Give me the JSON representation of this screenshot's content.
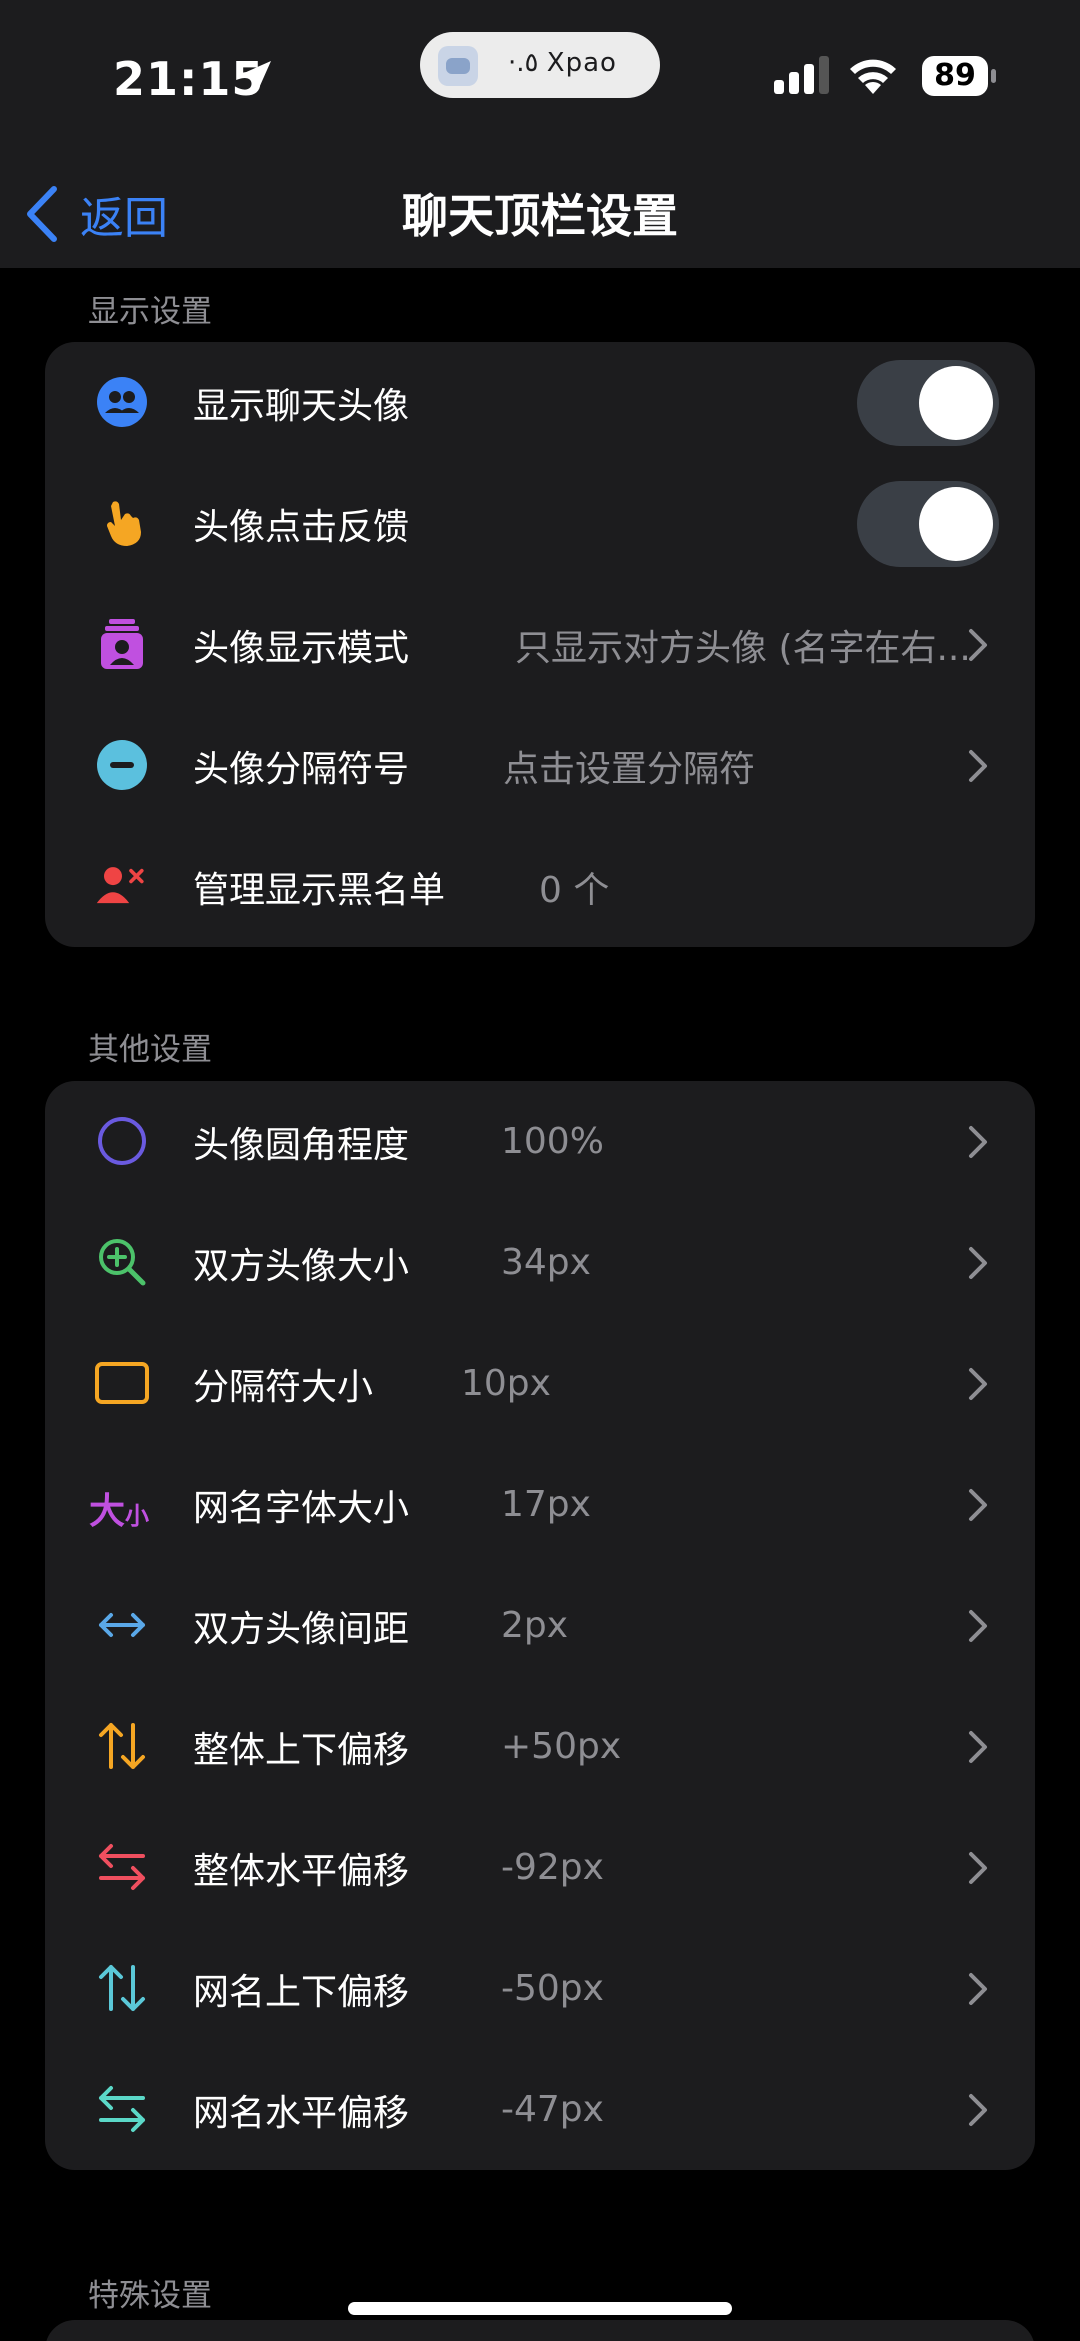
{
  "status_bar": {
    "time": "21:15",
    "island_text": "·.٥  Xpao",
    "battery": "89"
  },
  "nav": {
    "back_label": "返回",
    "title": "聊天顶栏设置"
  },
  "sections": [
    {
      "header": "显示设置",
      "rows": [
        {
          "icon": "people-icon",
          "label": "显示聊天头像",
          "value": "",
          "control": "toggle",
          "toggle_on": true
        },
        {
          "icon": "pointing-hand-icon",
          "label": "头像点击反馈",
          "value": "",
          "control": "toggle",
          "toggle_on": true
        },
        {
          "icon": "contact-card-icon",
          "label": "头像显示模式",
          "value": "只显示对方头像 (名字在右...",
          "control": "chevron"
        },
        {
          "icon": "minus-circle-icon",
          "label": "头像分隔符号",
          "value": "点击设置分隔符",
          "control": "chevron"
        },
        {
          "icon": "user-remove-icon",
          "label": "管理显示黑名单",
          "value": "0 个",
          "control": "none"
        }
      ]
    },
    {
      "header": "其他设置",
      "rows": [
        {
          "icon": "circle-outline-icon",
          "label": "头像圆角程度",
          "value": "100%",
          "control": "chevron"
        },
        {
          "icon": "zoom-in-icon",
          "label": "双方头像大小",
          "value": "34px",
          "control": "chevron"
        },
        {
          "icon": "rectangle-icon",
          "label": "分隔符大小",
          "value": "10px",
          "control": "chevron"
        },
        {
          "icon": "font-size-icon",
          "icon_text_big": "大",
          "icon_text_small": "小",
          "label": "网名字体大小",
          "value": "17px",
          "control": "chevron"
        },
        {
          "icon": "horizontal-arrows-icon",
          "label": "双方头像间距",
          "value": "2px",
          "control": "chevron"
        },
        {
          "icon": "vertical-arrows-icon",
          "label": "整体上下偏移",
          "value": "+50px",
          "control": "chevron"
        },
        {
          "icon": "swap-horizontal-icon",
          "label": "整体水平偏移",
          "value": "-92px",
          "control": "chevron"
        },
        {
          "icon": "vertical-arrows-icon",
          "label": "网名上下偏移",
          "value": "-50px",
          "control": "chevron"
        },
        {
          "icon": "swap-horizontal-icon",
          "label": "网名水平偏移",
          "value": "-47px",
          "control": "chevron"
        }
      ]
    },
    {
      "header": "特殊设置",
      "rows": []
    }
  ],
  "colors": {
    "accent": "#3b82f6",
    "background": "#000000",
    "card": "#1c1c1e",
    "secondary_text": "#8e8e93"
  }
}
